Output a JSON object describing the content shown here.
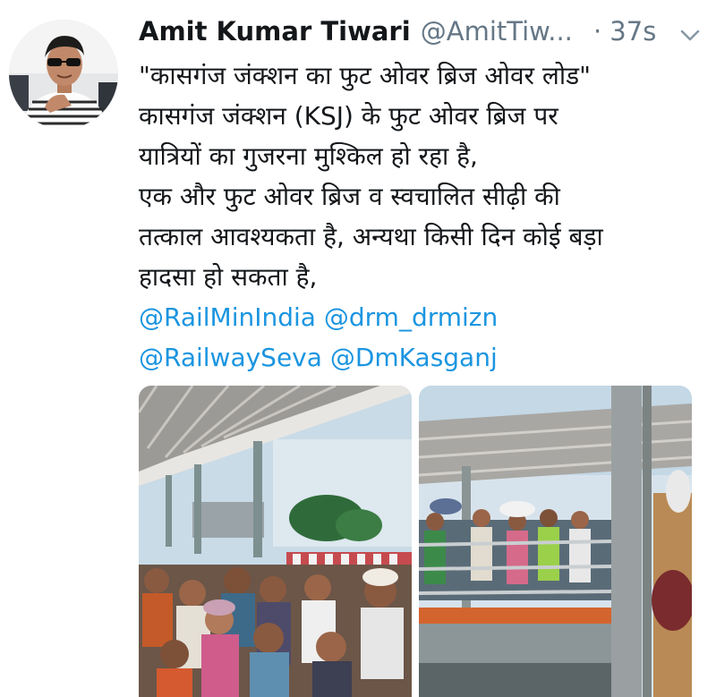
{
  "tweet": {
    "author_name": "Amit Kumar Tiwari",
    "author_handle": "@AmitTiw...",
    "separator": "·",
    "timestamp": "37s",
    "lines": [
      "\"कासगंज जंक्शन का फुट ओवर ब्रिज ओवर लोड\"",
      "कासगंज जंक्शन (KSJ) के फुट ओवर ब्रिज पर",
      "यात्रियों का गुजरना मुश्किल हो रहा है,",
      "एक और फुट ओवर ब्रिज व स्वचालित सीढ़ी की",
      "तत्काल आवश्यकता है, अन्यथा किसी दिन कोई बड़ा",
      "हादसा हो सकता है,"
    ],
    "mentions": [
      [
        "@RailMinIndia",
        "@drm_drmizn"
      ],
      [
        "@RailwaySeva",
        "@DmKasganj"
      ]
    ]
  },
  "icons": {
    "menu": "chevron-down-icon"
  },
  "colors": {
    "link": "#1b95e0",
    "muted": "#657786",
    "text": "#14171a"
  }
}
